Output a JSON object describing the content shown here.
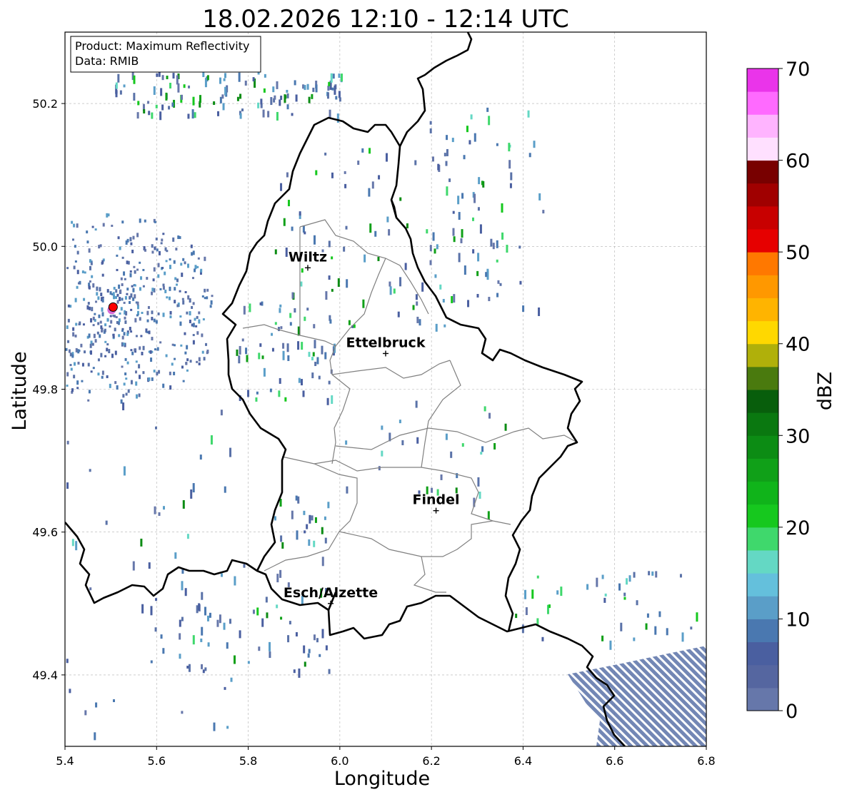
{
  "title": "18.02.2026 12:10 - 12:14 UTC",
  "info_box": {
    "product": "Product: Maximum Reflectivity",
    "data": "Data: RMIB"
  },
  "axes": {
    "xlabel": "Longitude",
    "ylabel": "Latitude",
    "xlim": [
      5.4,
      6.8
    ],
    "ylim": [
      49.3,
      50.3
    ],
    "xticks": [
      "5.4",
      "5.6",
      "5.8",
      "6.0",
      "6.2",
      "6.4",
      "6.6",
      "6.8"
    ],
    "yticks": [
      "49.4",
      "49.6",
      "49.8",
      "50.0",
      "50.2"
    ],
    "grid": true
  },
  "colorbar": {
    "label": "dBZ",
    "range": [
      0,
      70
    ],
    "ticks": [
      "0",
      "10",
      "20",
      "30",
      "40",
      "50",
      "60",
      "70"
    ],
    "colors": [
      "#6677aa",
      "#5566a0",
      "#4a5fa0",
      "#4a78b0",
      "#5a9ec8",
      "#64c0dc",
      "#64d8c4",
      "#3fd86c",
      "#16c81e",
      "#10b41a",
      "#10a018",
      "#0c8c14",
      "#0a7810",
      "#085e0c",
      "#4a7a0e",
      "#b0b00a",
      "#ffd800",
      "#ffb400",
      "#ff9800",
      "#ff7800",
      "#e60000",
      "#c80000",
      "#a00000",
      "#780000",
      "#ffe0ff",
      "#ffb4ff",
      "#ff6aff",
      "#ea34ea"
    ]
  },
  "cities": [
    {
      "name": "Wiltz",
      "lon": 5.93,
      "lat": 49.97
    },
    {
      "name": "Ettelbruck",
      "lon": 6.1,
      "lat": 49.85
    },
    {
      "name": "Findel",
      "lon": 6.21,
      "lat": 49.63
    },
    {
      "name": "Esch/Alzette",
      "lon": 5.98,
      "lat": 49.5
    }
  ],
  "radar_marker": {
    "lon": 5.505,
    "lat": 49.915,
    "color": "#ff0000"
  },
  "colors": {
    "border": "#000000",
    "canton_lines": "#808080",
    "grid": "#b0b0b0"
  }
}
